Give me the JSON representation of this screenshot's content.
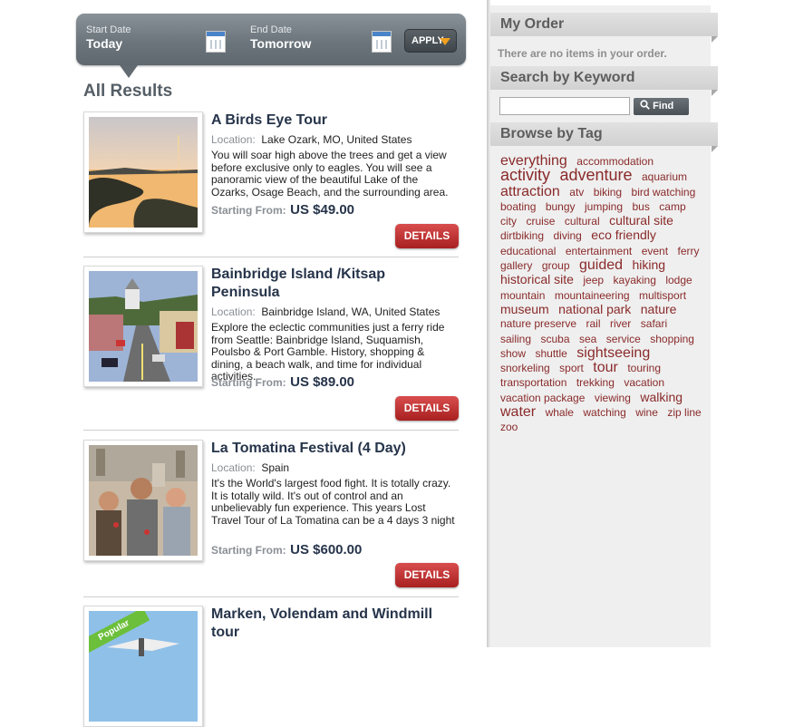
{
  "date_bar": {
    "start_label": "Start Date",
    "start_value": "Today",
    "end_label": "End Date",
    "end_value": "Tomorrow",
    "apply_label": "APPLY"
  },
  "results_title": "All Results",
  "labels": {
    "location": "Location:",
    "starting_from": "Starting From:",
    "details": "DETAILS"
  },
  "tours": [
    {
      "title": "A Birds Eye Tour",
      "location": "Lake Ozark, MO, United States",
      "description": "You will soar high above the trees and get a view before exclusive only to eagles. You will see a panoramic view of the beautiful Lake of the Ozarks, Osage Beach, and the surrounding area.",
      "price": "US $49.00"
    },
    {
      "title": "Bainbridge Island /Kitsap Peninsula",
      "location": "Bainbridge Island, WA, United States",
      "description": "Explore the eclectic communities just a ferry ride from Seattle: Bainbridge Island, Suquamish, Poulsbo & Port Gamble. History, shopping & dining, a beach walk, and time for individual activities.",
      "price": "US $89.00"
    },
    {
      "title": "La Tomatina Festival (4 Day)",
      "location": "Spain",
      "description": "It's the World's largest food fight. It is totally crazy. It is totally wild. It's out of control and an unbelievably fun experience. This years Lost Travel Tour of La Tomatina can be a 4 days 3 night",
      "price": "US $600.00"
    },
    {
      "title": "Marken, Volendam and Windmill tour",
      "badge": "Popular"
    }
  ],
  "sidebar": {
    "order_title": "My Order",
    "order_empty": "There are no items in your order.",
    "search_title": "Search by Keyword",
    "search_value": "",
    "find_label": "Find",
    "tags_title": "Browse by Tag",
    "tags": [
      {
        "label": "everything",
        "size": "s3"
      },
      {
        "label": "accommodation",
        "size": "s1"
      },
      {
        "label": "activity",
        "size": "s4"
      },
      {
        "label": "adventure",
        "size": "s4"
      },
      {
        "label": "aquarium",
        "size": "s1"
      },
      {
        "label": "attraction",
        "size": "s3"
      },
      {
        "label": "atv",
        "size": "s1"
      },
      {
        "label": "biking",
        "size": "s1"
      },
      {
        "label": "bird watching",
        "size": "s1"
      },
      {
        "label": "boating",
        "size": "s1"
      },
      {
        "label": "bungy",
        "size": "s1"
      },
      {
        "label": "jumping",
        "size": "s1"
      },
      {
        "label": "bus",
        "size": "s1"
      },
      {
        "label": "camp",
        "size": "s1"
      },
      {
        "label": "city",
        "size": "s1"
      },
      {
        "label": "cruise",
        "size": "s1"
      },
      {
        "label": "cultural",
        "size": "s1"
      },
      {
        "label": "cultural site",
        "size": "s2"
      },
      {
        "label": "dirtbiking",
        "size": "s1"
      },
      {
        "label": "diving",
        "size": "s1"
      },
      {
        "label": "eco friendly",
        "size": "s2"
      },
      {
        "label": "educational",
        "size": "s1"
      },
      {
        "label": "entertainment",
        "size": "s1"
      },
      {
        "label": "event",
        "size": "s1"
      },
      {
        "label": "ferry",
        "size": "s1"
      },
      {
        "label": "gallery",
        "size": "s1"
      },
      {
        "label": "group",
        "size": "s1"
      },
      {
        "label": "guided",
        "size": "s3"
      },
      {
        "label": "hiking",
        "size": "s2"
      },
      {
        "label": "historical site",
        "size": "s2"
      },
      {
        "label": "jeep",
        "size": "s1"
      },
      {
        "label": "kayaking",
        "size": "s1"
      },
      {
        "label": "lodge",
        "size": "s1"
      },
      {
        "label": "mountain",
        "size": "s1"
      },
      {
        "label": "mountaineering",
        "size": "s1"
      },
      {
        "label": "multisport",
        "size": "s1"
      },
      {
        "label": "museum",
        "size": "s2"
      },
      {
        "label": "national park",
        "size": "s2"
      },
      {
        "label": "nature",
        "size": "s2"
      },
      {
        "label": "nature preserve",
        "size": "s1"
      },
      {
        "label": "rail",
        "size": "s1"
      },
      {
        "label": "river",
        "size": "s1"
      },
      {
        "label": "safari",
        "size": "s1"
      },
      {
        "label": "sailing",
        "size": "s1"
      },
      {
        "label": "scuba",
        "size": "s1"
      },
      {
        "label": "sea",
        "size": "s1"
      },
      {
        "label": "service",
        "size": "s1"
      },
      {
        "label": "shopping",
        "size": "s1"
      },
      {
        "label": "show",
        "size": "s1"
      },
      {
        "label": "shuttle",
        "size": "s1"
      },
      {
        "label": "sightseeing",
        "size": "s3"
      },
      {
        "label": "snorkeling",
        "size": "s1"
      },
      {
        "label": "sport",
        "size": "s1"
      },
      {
        "label": "tour",
        "size": "s3"
      },
      {
        "label": "touring",
        "size": "s1"
      },
      {
        "label": "transportation",
        "size": "s1"
      },
      {
        "label": "trekking",
        "size": "s1"
      },
      {
        "label": "vacation",
        "size": "s1"
      },
      {
        "label": "vacation package",
        "size": "s1"
      },
      {
        "label": "viewing",
        "size": "s1"
      },
      {
        "label": "walking",
        "size": "s2"
      },
      {
        "label": "water",
        "size": "s3"
      },
      {
        "label": "whale",
        "size": "s1"
      },
      {
        "label": "watching",
        "size": "s1"
      },
      {
        "label": "wine",
        "size": "s1"
      },
      {
        "label": "zip line",
        "size": "s1"
      },
      {
        "label": "zoo",
        "size": "s1"
      }
    ]
  },
  "colors": {
    "tag_link": "#8a2a2a",
    "details_button": "#c83232",
    "apply_arrow": "#f0a020",
    "title_text": "#26344a"
  }
}
